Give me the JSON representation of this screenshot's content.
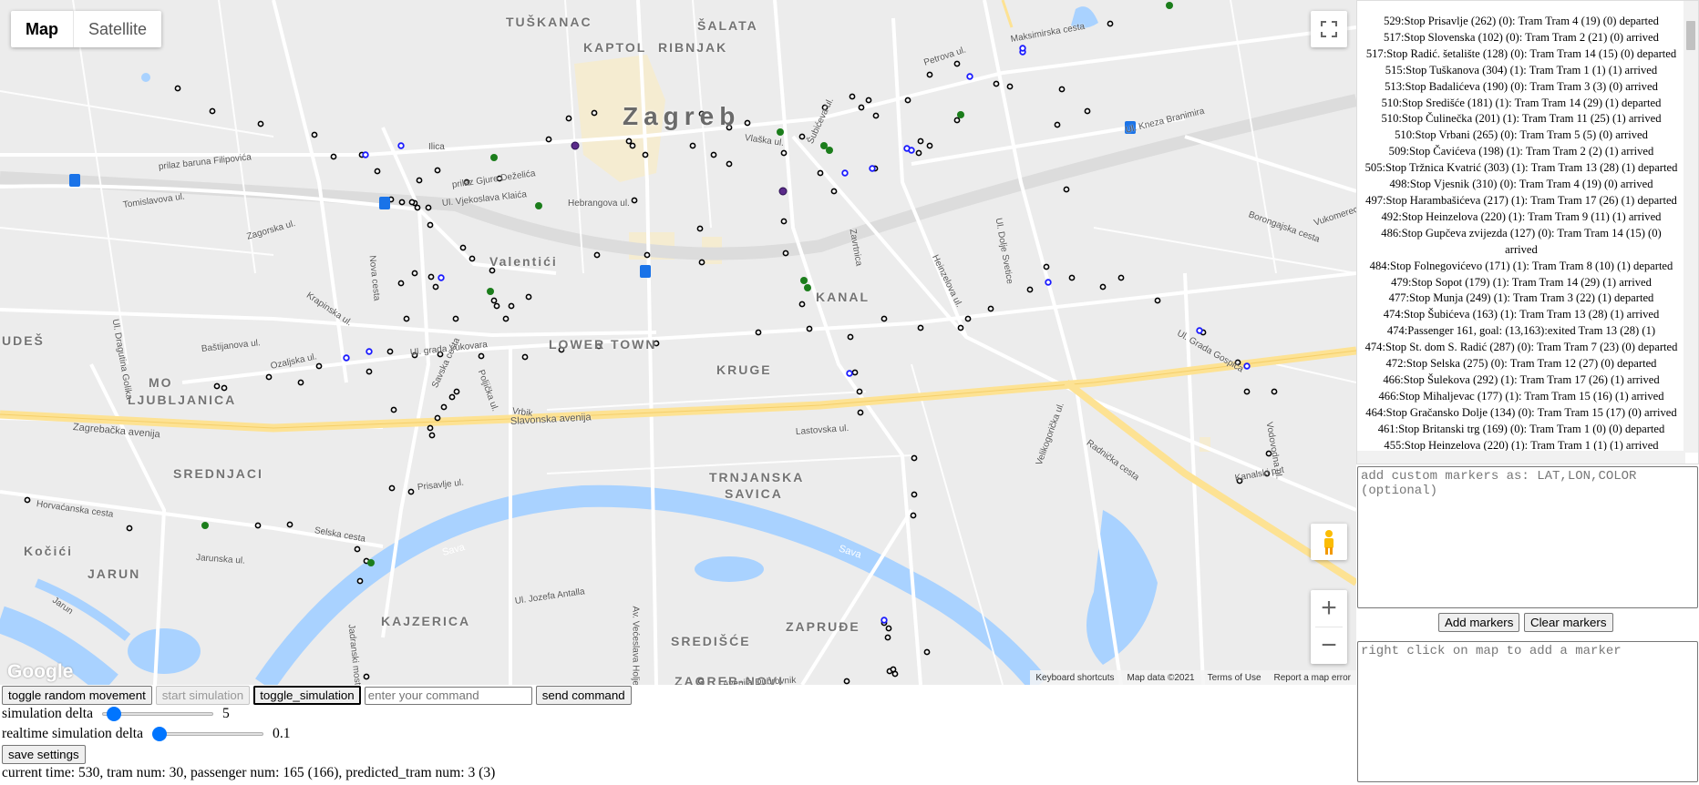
{
  "map": {
    "type_map": "Map",
    "type_satellite": "Satellite",
    "logo": "Google",
    "attribution": [
      "Keyboard shortcuts",
      "Map data ©2021",
      "Terms of Use",
      "Report a map error"
    ],
    "city_label": "Zagreb",
    "districts": [
      "TUŠKANAC",
      "ŠALATA",
      "KAPTOL",
      "RIBNJAK",
      "Valentići",
      "KANAL",
      "LOWER TOWN",
      "KRUGE",
      "MO",
      "LJUBLJANICA",
      "SREDNJACI",
      "TRNJANSKA",
      "SAVICA",
      "Kočići",
      "JARUN",
      "KAJZERICA",
      "ZAPRUĐE",
      "SREDIŠĆE",
      "ZAGREB-NOVI",
      "UDEŠ"
    ],
    "streets": [
      "Ilica",
      "prilaz baruna Filipovića",
      "Tomislavova ul.",
      "Zagorska ul.",
      "prilaz Gjure Deželića",
      "Ul. Vjekoslava Klaića",
      "Hebrangova ul.",
      "Vlaška ul.",
      "Maksimirska cesta",
      "Ul. Kneza Branimira",
      "Petrova ul.",
      "Ul. grada Vukovara",
      "Slavonska avenija",
      "Zagrebačka avenija",
      "Radnička cesta",
      "Prisavlje ul.",
      "Horvaćanska cesta",
      "Selska cesta",
      "Jarunska ul.",
      "Ul. Jozefa Antalla",
      "Av. Većeslava Holjevca",
      "Lastovska ul.",
      "Heinzelova ul.",
      "Borongajska cesta",
      "Vukomerec ul.",
      "Ul. Grada Gospića",
      "Ozaljska ul.",
      "Krapinska ul.",
      "Baštijanova ul.",
      "Ul. Dragutina Golika",
      "Nova cesta",
      "Savska cesta",
      "Poljička ul.",
      "Vrbik",
      "Zavrtnica",
      "Ul. Dolje Svetice",
      "Kanalski put",
      "Avenija Dubrovnik",
      "Šubićeva ul.",
      "Vodovodna ul.",
      "Velikogorička ul.",
      "Jadranski most"
    ],
    "rivers": [
      "Sava",
      "Sava"
    ],
    "jarun_label": "Jarun"
  },
  "events": [
    "529:Stop Prisavlje (262) (0): Tram Tram 4 (19) (0) departed",
    "517:Stop Slovenska (102) (0): Tram Tram 2 (21) (0) arrived",
    "517:Stop Radić. šetalište (128) (0): Tram Tram 14 (15) (0) departed",
    "515:Stop Tuškanova (304) (1): Tram Tram 1 (1) (1) arrived",
    "513:Stop Badalićeva (190) (0): Tram Tram 3 (3) (0) arrived",
    "510:Stop Središće (181) (1): Tram Tram 14 (29) (1) departed",
    "510:Stop Čulinečka (201) (1): Tram Tram 11 (25) (1) arrived",
    "510:Stop Vrbani (265) (0): Tram Tram 5 (5) (0) arrived",
    "509:Stop Čavićeva (198) (1): Tram Tram 2 (2) (1) arrived",
    "505:Stop Tržnica Kvatrić (303) (1): Tram Tram 13 (28) (1) departed",
    "498:Stop Vjesnik (310) (0): Tram Tram 4 (19) (0) arrived",
    "497:Stop Harambašićeva (217) (1): Tram Tram 17 (26) (1) departed",
    "492:Stop Heinzelova (220) (1): Tram Tram 9 (11) (1) arrived",
    "486:Stop Gupčeva zvijezda (127) (0): Tram Tram 14 (15) (0)",
    "arrived",
    "484:Stop Folnegovićevo (171) (1): Tram Tram 8 (10) (1) departed",
    "479:Stop Sopot (179) (1): Tram Tram 14 (29) (1) arrived",
    "477:Stop Munja (249) (1): Tram Tram 3 (22) (1) departed",
    "474:Stop Šubićeva (163) (1): Tram Tram 13 (28) (1) arrived",
    "474:Passenger 161, goal: (13,163):exited Tram 13 (28) (1)",
    "474:Stop St. dom S. Radić (287) (0): Tram Tram 7 (23) (0) departed",
    "472:Stop Selska (275) (0): Tram Tram 12 (27) (0) departed",
    "466:Stop Šulekova (292) (1): Tram Tram 17 (26) (1) arrived",
    "466:Stop Mihaljevac (177) (1): Tram Tram 15 (16) (1) arrived",
    "464:Stop Gračansko Dolje (134) (0): Tram Tram 15 (17) (0) arrived",
    "461:Stop Britanski trg (169) (0): Tram Tram 1 (0) (0) departed",
    "455:Stop Heinzelova (220) (1): Tram Tram 1 (1) (1) arrived"
  ],
  "markers_placeholder": "add custom markers as: LAT,LON,COLOR (optional)",
  "add_markers_label": "Add markers",
  "clear_markers_label": "Clear markers",
  "right_click_placeholder": "right click on map to add a marker",
  "controls": {
    "toggle_random_movement": "toggle random movement",
    "start_simulation": "start simulation",
    "toggle_simulation": "toggle_simulation",
    "command_placeholder": "enter your command",
    "send_command": "send command",
    "simulation_delta_label": "simulation delta",
    "simulation_delta_value": "5",
    "simulation_delta_fraction": 0.05,
    "realtime_delta_label": "realtime simulation delta",
    "realtime_delta_value": "0.1",
    "realtime_delta_fraction": 0.0,
    "save_settings": "save settings",
    "status": "current time: 530, tram num: 30, passenger num: 165 (166), predicted_tram num: 3 (3)"
  },
  "colors": {
    "water": "#a9d2ff",
    "avenue": "#fde293",
    "road": "#ffffff",
    "slider": "#0075ff",
    "marker_blue": "#1a1aff",
    "marker_green": "#1b7d1b"
  }
}
